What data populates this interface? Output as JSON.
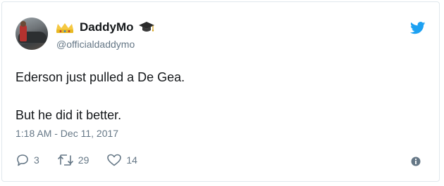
{
  "user": {
    "display_name": "DaddyMo",
    "handle": "@officialdaddymo"
  },
  "icons": {
    "crown": "crown-emoji-icon",
    "graduation": "graduation-cap-emoji-icon",
    "bird": "twitter-bird-icon",
    "reply": "reply-icon",
    "retweet": "retweet-icon",
    "like": "heart-icon",
    "info": "info-icon"
  },
  "tweet": {
    "line1": "Ederson just pulled a De Gea.",
    "line2": "But he did it better.",
    "timestamp": "1:18 AM - Dec 11, 2017"
  },
  "actions": {
    "replies": "3",
    "retweets": "29",
    "likes": "14"
  },
  "colors": {
    "twitter_blue": "#1da1f2",
    "secondary_text": "#657786",
    "primary_text": "#14171a"
  }
}
